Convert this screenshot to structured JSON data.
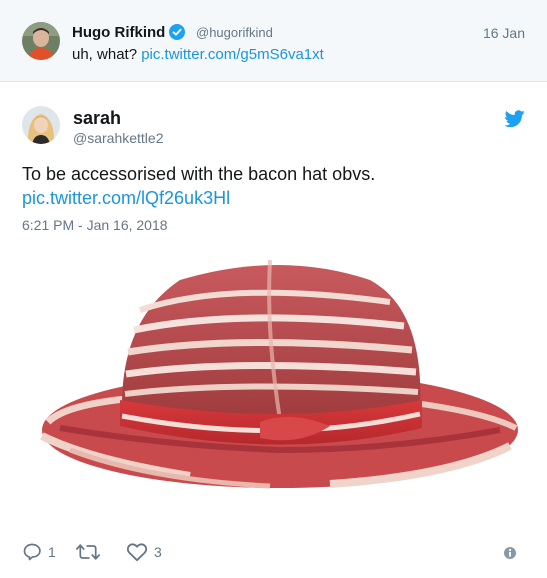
{
  "parent_tweet": {
    "name": "Hugo Rifkind",
    "handle": "@hugorifkind",
    "date": "16 Jan",
    "text": "uh, what?",
    "link": "pic.twitter.com/g5mS6va1xt"
  },
  "tweet": {
    "name": "sarah",
    "handle": "@sarahkettle2",
    "text": "To be accessorised with the bacon hat obvs.",
    "link": "pic.twitter.com/lQf26uk3Hl",
    "timestamp": "6:21 PM - Jan 16, 2018",
    "media_description_icon": "bacon-hat-image"
  },
  "actions": {
    "reply_count": "1",
    "retweet_count": "",
    "like_count": "3"
  },
  "icons": {
    "verified": "verified-badge-icon",
    "bird": "twitter-bird-icon",
    "reply": "reply-icon",
    "retweet": "retweet-icon",
    "like": "heart-icon",
    "info": "info-icon"
  },
  "colors": {
    "link": "#1b95e0",
    "muted": "#657786",
    "parent_bg": "#f5f8fa",
    "brand": "#1da1f2"
  }
}
